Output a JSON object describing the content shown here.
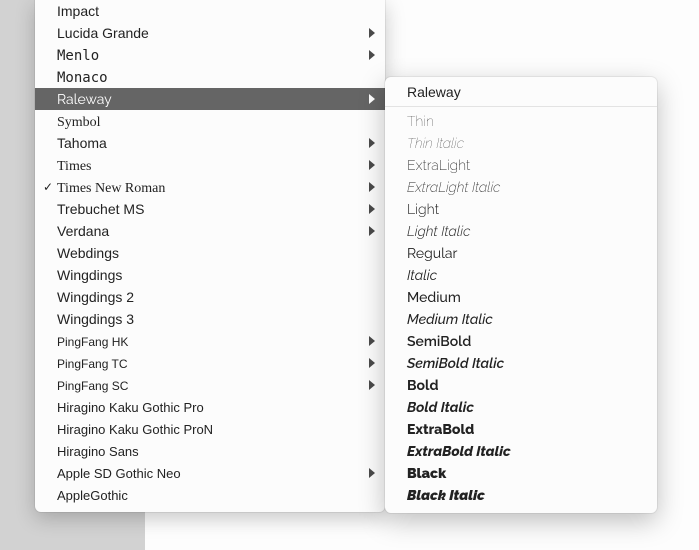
{
  "font_menu": {
    "items": [
      {
        "label": "Impact",
        "font": "Impact, Charcoal, sans-serif",
        "submenu": false,
        "checked": false,
        "highlight": false
      },
      {
        "label": "Lucida Grande",
        "font": "'Lucida Grande','Lucida Sans',sans-serif",
        "submenu": true,
        "checked": false,
        "highlight": false
      },
      {
        "label": "Menlo",
        "font": "Menlo, monospace",
        "submenu": true,
        "checked": false,
        "highlight": false
      },
      {
        "label": "Monaco",
        "font": "Monaco, monospace",
        "submenu": false,
        "checked": false,
        "highlight": false
      },
      {
        "label": "Raleway",
        "font": "Raleway, Arial, sans-serif",
        "submenu": true,
        "checked": false,
        "highlight": true
      },
      {
        "label": "Symbol",
        "font": "Symbol, serif",
        "submenu": false,
        "checked": false,
        "highlight": false
      },
      {
        "label": "Tahoma",
        "font": "Tahoma, sans-serif",
        "submenu": true,
        "checked": false,
        "highlight": false
      },
      {
        "label": "Times",
        "font": "Times, serif",
        "submenu": true,
        "checked": false,
        "highlight": false
      },
      {
        "label": "Times New Roman",
        "font": "'Times New Roman', serif",
        "submenu": true,
        "checked": true,
        "highlight": false
      },
      {
        "label": "Trebuchet MS",
        "font": "'Trebuchet MS', sans-serif",
        "submenu": true,
        "checked": false,
        "highlight": false
      },
      {
        "label": "Verdana",
        "font": "Verdana, sans-serif",
        "submenu": true,
        "checked": false,
        "highlight": false
      },
      {
        "label": "Webdings",
        "font": "Arial, sans-serif",
        "submenu": false,
        "checked": false,
        "highlight": false
      },
      {
        "label": "Wingdings",
        "font": "Arial, sans-serif",
        "submenu": false,
        "checked": false,
        "highlight": false
      },
      {
        "label": "Wingdings 2",
        "font": "Arial, sans-serif",
        "submenu": false,
        "checked": false,
        "highlight": false
      },
      {
        "label": "Wingdings 3",
        "font": "Arial, sans-serif",
        "submenu": false,
        "checked": false,
        "highlight": false
      },
      {
        "label": "PingFang HK",
        "font": "'PingFang HK','PingFang SC',sans-serif",
        "submenu": true,
        "checked": false,
        "highlight": false,
        "size": "12px"
      },
      {
        "label": "PingFang TC",
        "font": "'PingFang TC','PingFang SC',sans-serif",
        "submenu": true,
        "checked": false,
        "highlight": false,
        "size": "12px"
      },
      {
        "label": "PingFang SC",
        "font": "'PingFang SC',sans-serif",
        "submenu": true,
        "checked": false,
        "highlight": false,
        "size": "12px"
      },
      {
        "label": "Hiragino Kaku Gothic Pro",
        "font": "'Hiragino Kaku Gothic Pro',sans-serif",
        "submenu": false,
        "checked": false,
        "highlight": false,
        "size": "13px"
      },
      {
        "label": "Hiragino Kaku Gothic ProN",
        "font": "'Hiragino Kaku Gothic ProN',sans-serif",
        "submenu": false,
        "checked": false,
        "highlight": false,
        "size": "13px"
      },
      {
        "label": "Hiragino Sans",
        "font": "'Hiragino Sans',sans-serif",
        "submenu": false,
        "checked": false,
        "highlight": false,
        "size": "13px"
      },
      {
        "label": "Apple SD Gothic Neo",
        "font": "'Apple SD Gothic Neo',sans-serif",
        "submenu": true,
        "checked": false,
        "highlight": false,
        "size": "13px"
      },
      {
        "label": "AppleGothic",
        "font": "AppleGothic, sans-serif",
        "submenu": false,
        "checked": false,
        "highlight": false,
        "size": "13px"
      }
    ]
  },
  "submenu": {
    "title": "Raleway",
    "items": [
      {
        "label": "Thin",
        "class": "thin"
      },
      {
        "label": "Thin Italic",
        "class": "thin italic"
      },
      {
        "label": "ExtraLight",
        "class": "extralight"
      },
      {
        "label": "ExtraLight Italic",
        "class": "extralight italic"
      },
      {
        "label": "Light",
        "class": "light"
      },
      {
        "label": "Light Italic",
        "class": "light italic"
      },
      {
        "label": "Regular",
        "class": "regular"
      },
      {
        "label": "Italic",
        "class": "regular italic"
      },
      {
        "label": "Medium",
        "class": "medium"
      },
      {
        "label": "Medium Italic",
        "class": "medium italic"
      },
      {
        "label": "SemiBold",
        "class": "semibold"
      },
      {
        "label": "SemiBold Italic",
        "class": "semibold italic"
      },
      {
        "label": "Bold",
        "class": "bold"
      },
      {
        "label": "Bold Italic",
        "class": "bold italic"
      },
      {
        "label": "ExtraBold",
        "class": "extrabold"
      },
      {
        "label": "ExtraBold Italic",
        "class": "extrabold italic"
      },
      {
        "label": "Black",
        "class": "black"
      },
      {
        "label": "Black Italic",
        "class": "black italic"
      }
    ]
  },
  "checkmark": "✓"
}
